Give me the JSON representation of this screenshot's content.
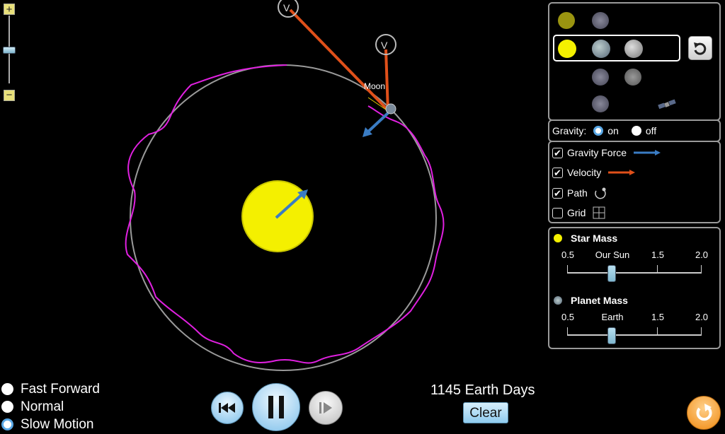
{
  "scene": {
    "labels": {
      "velocity_marker": "V",
      "moon_label": "Moon"
    }
  },
  "zoom": {
    "plus": "+",
    "minus": "−"
  },
  "bodies_panel": {
    "reset_icon": "reset-arrow-icon"
  },
  "gravity": {
    "label": "Gravity:",
    "on": "on",
    "off": "off",
    "selected": "on"
  },
  "options": [
    {
      "key": "gravity_force",
      "label": "Gravity Force",
      "checked": true
    },
    {
      "key": "velocity",
      "label": "Velocity",
      "checked": true
    },
    {
      "key": "path",
      "label": "Path",
      "checked": true
    },
    {
      "key": "grid",
      "label": "Grid",
      "checked": false
    }
  ],
  "star_mass": {
    "title": "Star Mass",
    "ticks": [
      "0.5",
      "Our Sun",
      "1.5",
      "2.0"
    ],
    "value": 1.0
  },
  "planet_mass": {
    "title": "Planet Mass",
    "ticks": [
      "0.5",
      "Earth",
      "1.5",
      "2.0"
    ],
    "value": 1.0
  },
  "speed": {
    "options": [
      "Fast Forward",
      "Normal",
      "Slow Motion"
    ],
    "selected": "Slow Motion"
  },
  "time": {
    "readout": "1145 Earth Days",
    "clear_label": "Clear"
  },
  "colors": {
    "star": "#f4f000",
    "path": "#e020e0",
    "gravity_arrow": "#3a7cc4",
    "velocity_arrow": "#e0501a",
    "orbit_ring": "#999999"
  }
}
